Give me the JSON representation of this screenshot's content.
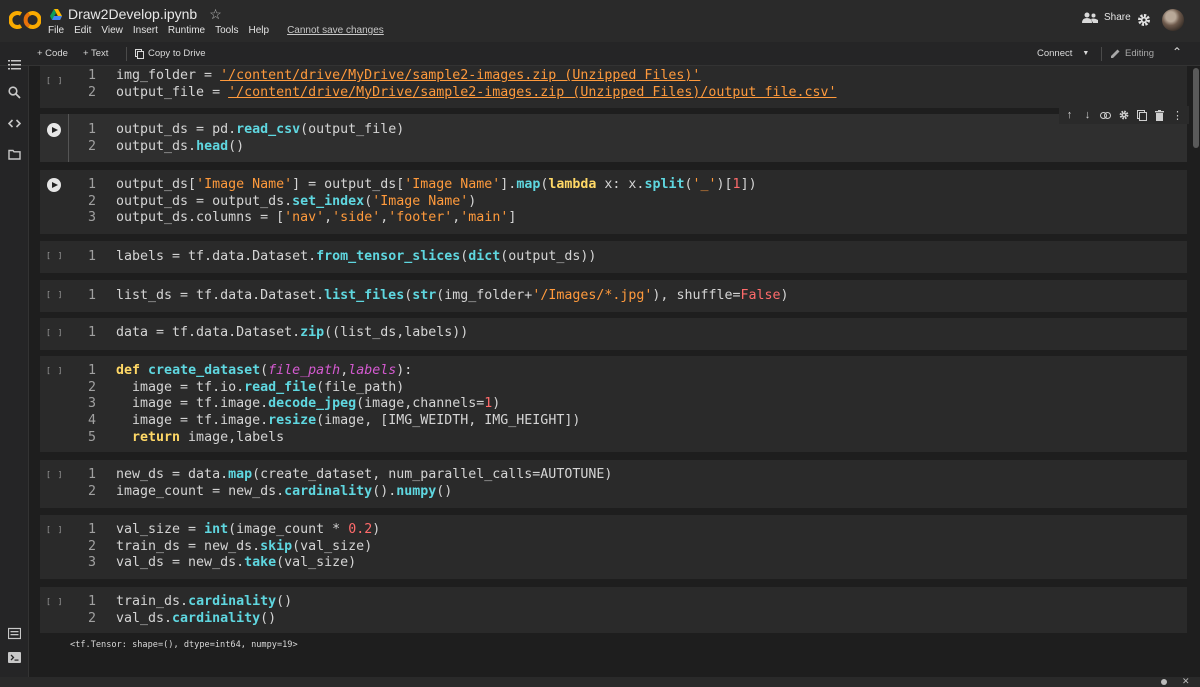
{
  "header": {
    "title": "Draw2Develop.ipynb",
    "menu": [
      "File",
      "Edit",
      "View",
      "Insert",
      "Runtime",
      "Tools",
      "Help"
    ],
    "warning": "Cannot save changes",
    "share_label": "Share",
    "icons": {
      "logo": "colab-logo",
      "drive": "drive-icon",
      "star": "star-icon",
      "share": "people-icon",
      "settings": "gear-icon",
      "account": "avatar"
    },
    "brand_color": "#f9ab00"
  },
  "toolbar": {
    "add_code": "+ Code",
    "add_text": "+ Text",
    "copy_drive": "Copy to Drive",
    "connect": "Connect",
    "editing": "Editing"
  },
  "sidebar": {
    "icons": [
      "toc-icon",
      "search-icon",
      "code-snippets-icon",
      "files-icon",
      "command-palette-icon",
      "terminal-icon"
    ]
  },
  "cells": [
    {
      "indicator": "[ ]",
      "lines": [
        "1",
        "2"
      ]
    },
    {
      "indicator": "run",
      "lines": [
        "1",
        "2"
      ]
    },
    {
      "indicator": "run",
      "lines": [
        "1",
        "2",
        "3"
      ]
    },
    {
      "indicator": "[ ]",
      "lines": [
        "1"
      ]
    },
    {
      "indicator": "[ ]",
      "lines": [
        "1"
      ]
    },
    {
      "indicator": "[ ]",
      "lines": [
        "1"
      ]
    },
    {
      "indicator": "[ ]",
      "lines": [
        "1",
        "2",
        "3",
        "4",
        "5"
      ]
    },
    {
      "indicator": "[ ]",
      "lines": [
        "1",
        "2"
      ]
    },
    {
      "indicator": "[ ]",
      "lines": [
        "1",
        "2",
        "3"
      ]
    },
    {
      "indicator": "[ ]",
      "lines": [
        "1",
        "2"
      ]
    }
  ],
  "code": {
    "c1_l1_a": "img_folder = ",
    "c1_l1_b": "'/content/drive/MyDrive/sample2-images.zip (Unzipped Files)'",
    "c1_l2_a": "output_file = ",
    "c1_l2_b": "'/content/drive/MyDrive/sample2-images.zip (Unzipped Files)/output file.csv'",
    "c2_l1_a": "output_ds = pd.",
    "c2_l1_f": "read_csv",
    "c2_l1_b": "(output_file)",
    "c2_l2_a": "output_ds.",
    "c2_l2_f": "head",
    "c2_l2_b": "()",
    "c3_l1_a": "output_ds[",
    "c3_l1_s1": "'Image Name'",
    "c3_l1_b": "] = output_ds[",
    "c3_l1_s2": "'Image Name'",
    "c3_l1_c": "].",
    "c3_l1_f1": "map",
    "c3_l1_d": "(",
    "c3_l1_k": "lambda",
    "c3_l1_e": " x: x.",
    "c3_l1_f2": "split",
    "c3_l1_g": "(",
    "c3_l1_s3": "'_'",
    "c3_l1_h": ")[",
    "c3_l1_n": "1",
    "c3_l1_i": "])",
    "c3_l2_a": "output_ds = output_ds.",
    "c3_l2_f": "set_index",
    "c3_l2_b": "(",
    "c3_l2_s": "'Image Name'",
    "c3_l2_c": ")",
    "c3_l3_a": "output_ds.columns = [",
    "c3_l3_s1": "'nav'",
    "c3_l3_s2": "'side'",
    "c3_l3_s3": "'footer'",
    "c3_l3_s4": "'main'",
    "c3_l3_b": "]",
    "c4_l1_a": "labels = tf.data.Dataset.",
    "c4_l1_f1": "from_tensor_slices",
    "c4_l1_b": "(",
    "c4_l1_f2": "dict",
    "c4_l1_c": "(output_ds))",
    "c5_l1_a": "list_ds = tf.data.Dataset.",
    "c5_l1_f1": "list_files",
    "c5_l1_b": "(",
    "c5_l1_f2": "str",
    "c5_l1_c": "(img_folder+",
    "c5_l1_s": "'/Images/*.jpg'",
    "c5_l1_d": "), shuffle=",
    "c5_l1_n": "False",
    "c5_l1_e": ")",
    "c6_l1_a": "data = tf.data.Dataset.",
    "c6_l1_f": "zip",
    "c6_l1_b": "((list_ds,labels))",
    "c7_l1_k": "def",
    "c7_l1_f": "create_dataset",
    "c7_l1_a": "(",
    "c7_l1_p1": "file_path",
    "c7_l1_p2": "labels",
    "c7_l1_b": "):",
    "c7_l2_a": "  image = tf.io.",
    "c7_l2_f": "read_file",
    "c7_l2_b": "(file_path)",
    "c7_l3_a": "  image = tf.image.",
    "c7_l3_f": "decode_jpeg",
    "c7_l3_b": "(image,channels=",
    "c7_l3_n": "1",
    "c7_l3_c": ")",
    "c7_l4_a": "  image = tf.image.",
    "c7_l4_f": "resize",
    "c7_l4_b": "(image, [IMG_WEIDTH, IMG_HEIGHT])",
    "c7_l5_k": "  return",
    "c7_l5_a": " image,labels",
    "c8_l1_a": "new_ds = data.",
    "c8_l1_f": "map",
    "c8_l1_b": "(create_dataset, num_parallel_calls=AUTOTUNE)",
    "c8_l2_a": "image_count = new_ds.",
    "c8_l2_f1": "cardinality",
    "c8_l2_b": "().",
    "c8_l2_f2": "numpy",
    "c8_l2_c": "()",
    "c9_l1_a": "val_size = ",
    "c9_l1_f": "int",
    "c9_l1_b": "(image_count * ",
    "c9_l1_n": "0.2",
    "c9_l1_c": ")",
    "c9_l2_a": "train_ds = new_ds.",
    "c9_l2_f": "skip",
    "c9_l2_b": "(val_size)",
    "c9_l3_a": "val_ds = new_ds.",
    "c9_l3_f": "take",
    "c9_l3_b": "(val_size)",
    "c10_l1_a": "train_ds.",
    "c10_l1_f": "cardinality",
    "c10_l1_b": "()",
    "c10_l2_a": "val_ds.",
    "c10_l2_f": "cardinality",
    "c10_l2_b": "()"
  },
  "output": "<tf.Tensor: shape=(), dtype=int64, numpy=19>"
}
